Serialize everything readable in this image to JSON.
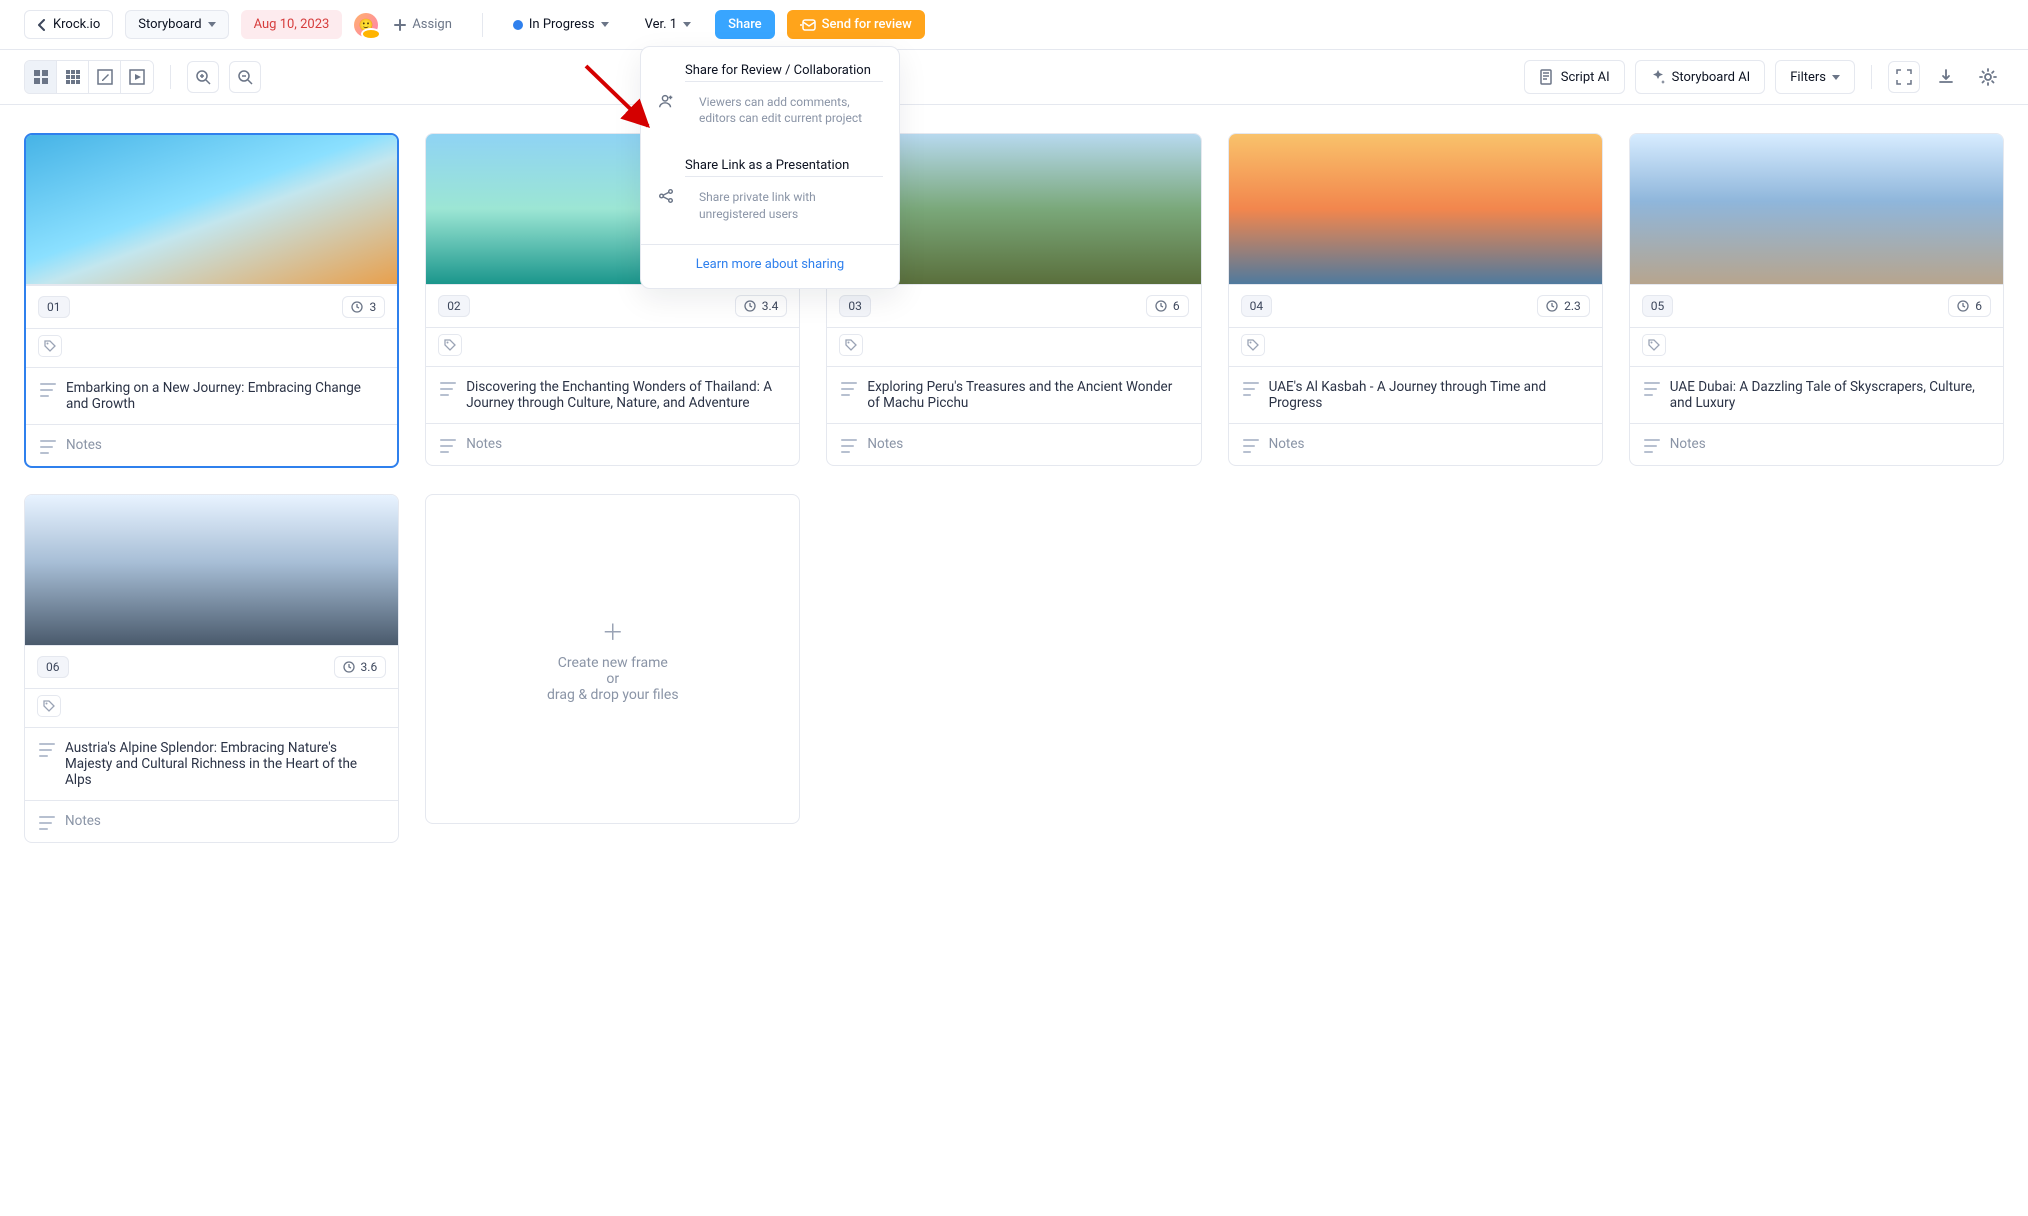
{
  "header": {
    "back_label": "Krock.io",
    "project_label": "Storyboard",
    "date": "Aug 10, 2023",
    "assign": "Assign",
    "status": "In Progress",
    "version": "Ver. 1",
    "share": "Share",
    "send_for_review": "Send for review"
  },
  "share_menu": {
    "collab_title": "Share for Review / Collaboration",
    "collab_desc": "Viewers can add comments, editors can edit current project",
    "present_title": "Share Link as a Presentation",
    "present_desc": "Share private link with unregistered users",
    "learn_more": "Learn more about sharing"
  },
  "toolbar": {
    "script_ai": "Script AI",
    "storyboard_ai": "Storyboard AI",
    "filters": "Filters"
  },
  "frames": [
    {
      "id": "01",
      "dur": "3",
      "title": "Embarking on a New Journey: Embracing Change and Growth",
      "thumb": "t1",
      "notes": "Notes"
    },
    {
      "id": "02",
      "dur": "3.4",
      "title": "Discovering the Enchanting Wonders of Thailand: A Journey through Culture, Nature, and Adventure",
      "thumb": "t2",
      "notes": "Notes"
    },
    {
      "id": "03",
      "dur": "6",
      "title": "Exploring Peru's Treasures and the Ancient Wonder of Machu Picchu",
      "thumb": "t3",
      "notes": "Notes"
    },
    {
      "id": "04",
      "dur": "2.3",
      "title": "UAE's Al Kasbah - A Journey through Time and Progress",
      "thumb": "t4",
      "notes": "Notes"
    },
    {
      "id": "05",
      "dur": "6",
      "title": "UAE Dubai: A Dazzling Tale of Skyscrapers, Culture, and Luxury",
      "thumb": "t5",
      "notes": "Notes"
    },
    {
      "id": "06",
      "dur": "3.6",
      "title": "Austria's Alpine Splendor: Embracing Nature's Majesty and Cultural Richness in the Heart of the Alps",
      "thumb": "t6",
      "notes": "Notes"
    }
  ],
  "create": {
    "line1": "Create new frame",
    "or": "or",
    "line2": "drag & drop your files"
  }
}
